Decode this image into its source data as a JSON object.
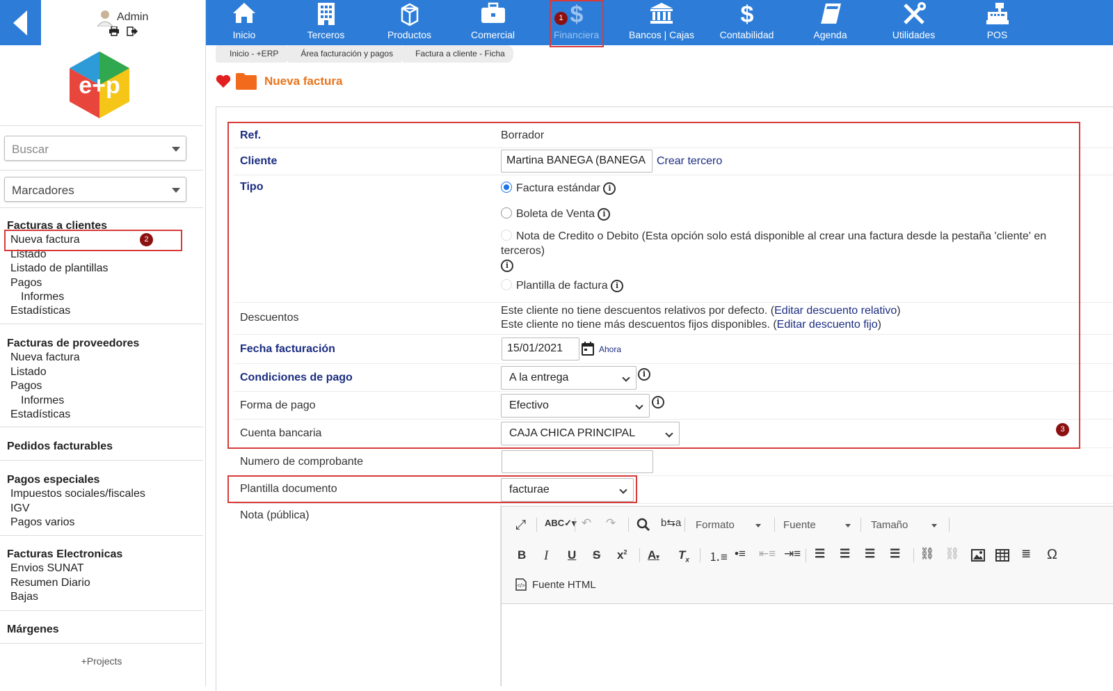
{
  "user": {
    "name": "Admin"
  },
  "sidebar": {
    "search_placeholder": "Buscar",
    "bookmarks_placeholder": "Marcadores",
    "sections": [
      {
        "title": "Facturas a clientes",
        "items": [
          "Nueva factura",
          "Listado",
          "Listado de plantillas",
          "Pagos",
          "Informes",
          "Estadísticas"
        ]
      },
      {
        "title": "Facturas de proveedores",
        "items": [
          "Nueva factura",
          "Listado",
          "Pagos",
          "Informes",
          "Estadísticas"
        ]
      },
      {
        "title": "Pedidos facturables"
      },
      {
        "title": "Pagos especiales",
        "items": [
          "Impuestos sociales/fiscales",
          "IGV",
          "Pagos varios"
        ]
      },
      {
        "title": "Facturas Electronicas",
        "items": [
          "Envios SUNAT",
          "Resumen Diario",
          "Bajas"
        ]
      },
      {
        "title": "Márgenes"
      }
    ],
    "footer": "+Projects"
  },
  "topnav": {
    "tabs": [
      {
        "label": "Inicio",
        "icon": "home-icon"
      },
      {
        "label": "Terceros",
        "icon": "building-icon"
      },
      {
        "label": "Productos",
        "icon": "box-icon"
      },
      {
        "label": "Comercial",
        "icon": "briefcase-icon"
      },
      {
        "label": "Financiera",
        "icon": "dollar-icon"
      },
      {
        "label": "Bancos | Cajas",
        "icon": "bank-icon"
      },
      {
        "label": "Contabilidad",
        "icon": "dollar-icon"
      },
      {
        "label": "Agenda",
        "icon": "book-icon"
      },
      {
        "label": "Utilidades",
        "icon": "tools-icon"
      },
      {
        "label": "POS",
        "icon": "cash-register-icon"
      }
    ]
  },
  "breadcrumb": [
    "Inicio - +ERP",
    "Área facturación y pagos",
    "Factura a cliente - Ficha"
  ],
  "page": {
    "title": "Nueva factura"
  },
  "annotations": {
    "badge1": "1",
    "badge2": "2",
    "badge3": "3"
  },
  "form": {
    "ref_label": "Ref.",
    "ref_value": "Borrador",
    "client_label": "Cliente",
    "client_value": "Martina BANEGA (BANEGA",
    "client_link": "Crear tercero",
    "type_label": "Tipo",
    "type_options": [
      "Factura estándar",
      "Boleta de Venta",
      "Nota de Credito o Debito (Esta opción solo está disponible al crear una factura desde la pestaña 'cliente' en terceros)",
      "Plantilla de factura"
    ],
    "discounts_label": "Descuentos",
    "discount_line1_pre": "Este cliente no tiene descuentos relativos por defecto. (",
    "discount_line1_link": "Editar descuento relativo",
    "discount_line2_pre": "Este cliente no tiene más descuentos fijos disponibles. (",
    "discount_line2_link": "Editar descuento fijo",
    "close_paren": ")",
    "date_label": "Fecha facturación",
    "date_value": "15/01/2021",
    "date_now": "Ahora",
    "payment_terms_label": "Condiciones de pago",
    "payment_terms_value": "A la entrega",
    "payment_method_label": "Forma de pago",
    "payment_method_value": "Efectivo",
    "bank_label": "Cuenta bancaria",
    "bank_value": "CAJA CHICA PRINCIPAL",
    "voucher_label": "Numero de comprobante",
    "voucher_value": "",
    "template_label": "Plantilla documento",
    "template_value": "facturae",
    "note_label": "Nota (pública)"
  },
  "editor": {
    "format": "Formato",
    "font": "Fuente",
    "size": "Tamaño",
    "source": "Fuente HTML"
  },
  "colors": {
    "topbar": "#2d7dd8",
    "accent": "#e8741b",
    "label_required": "#1a2c80",
    "annotation": "#d83a3a"
  }
}
